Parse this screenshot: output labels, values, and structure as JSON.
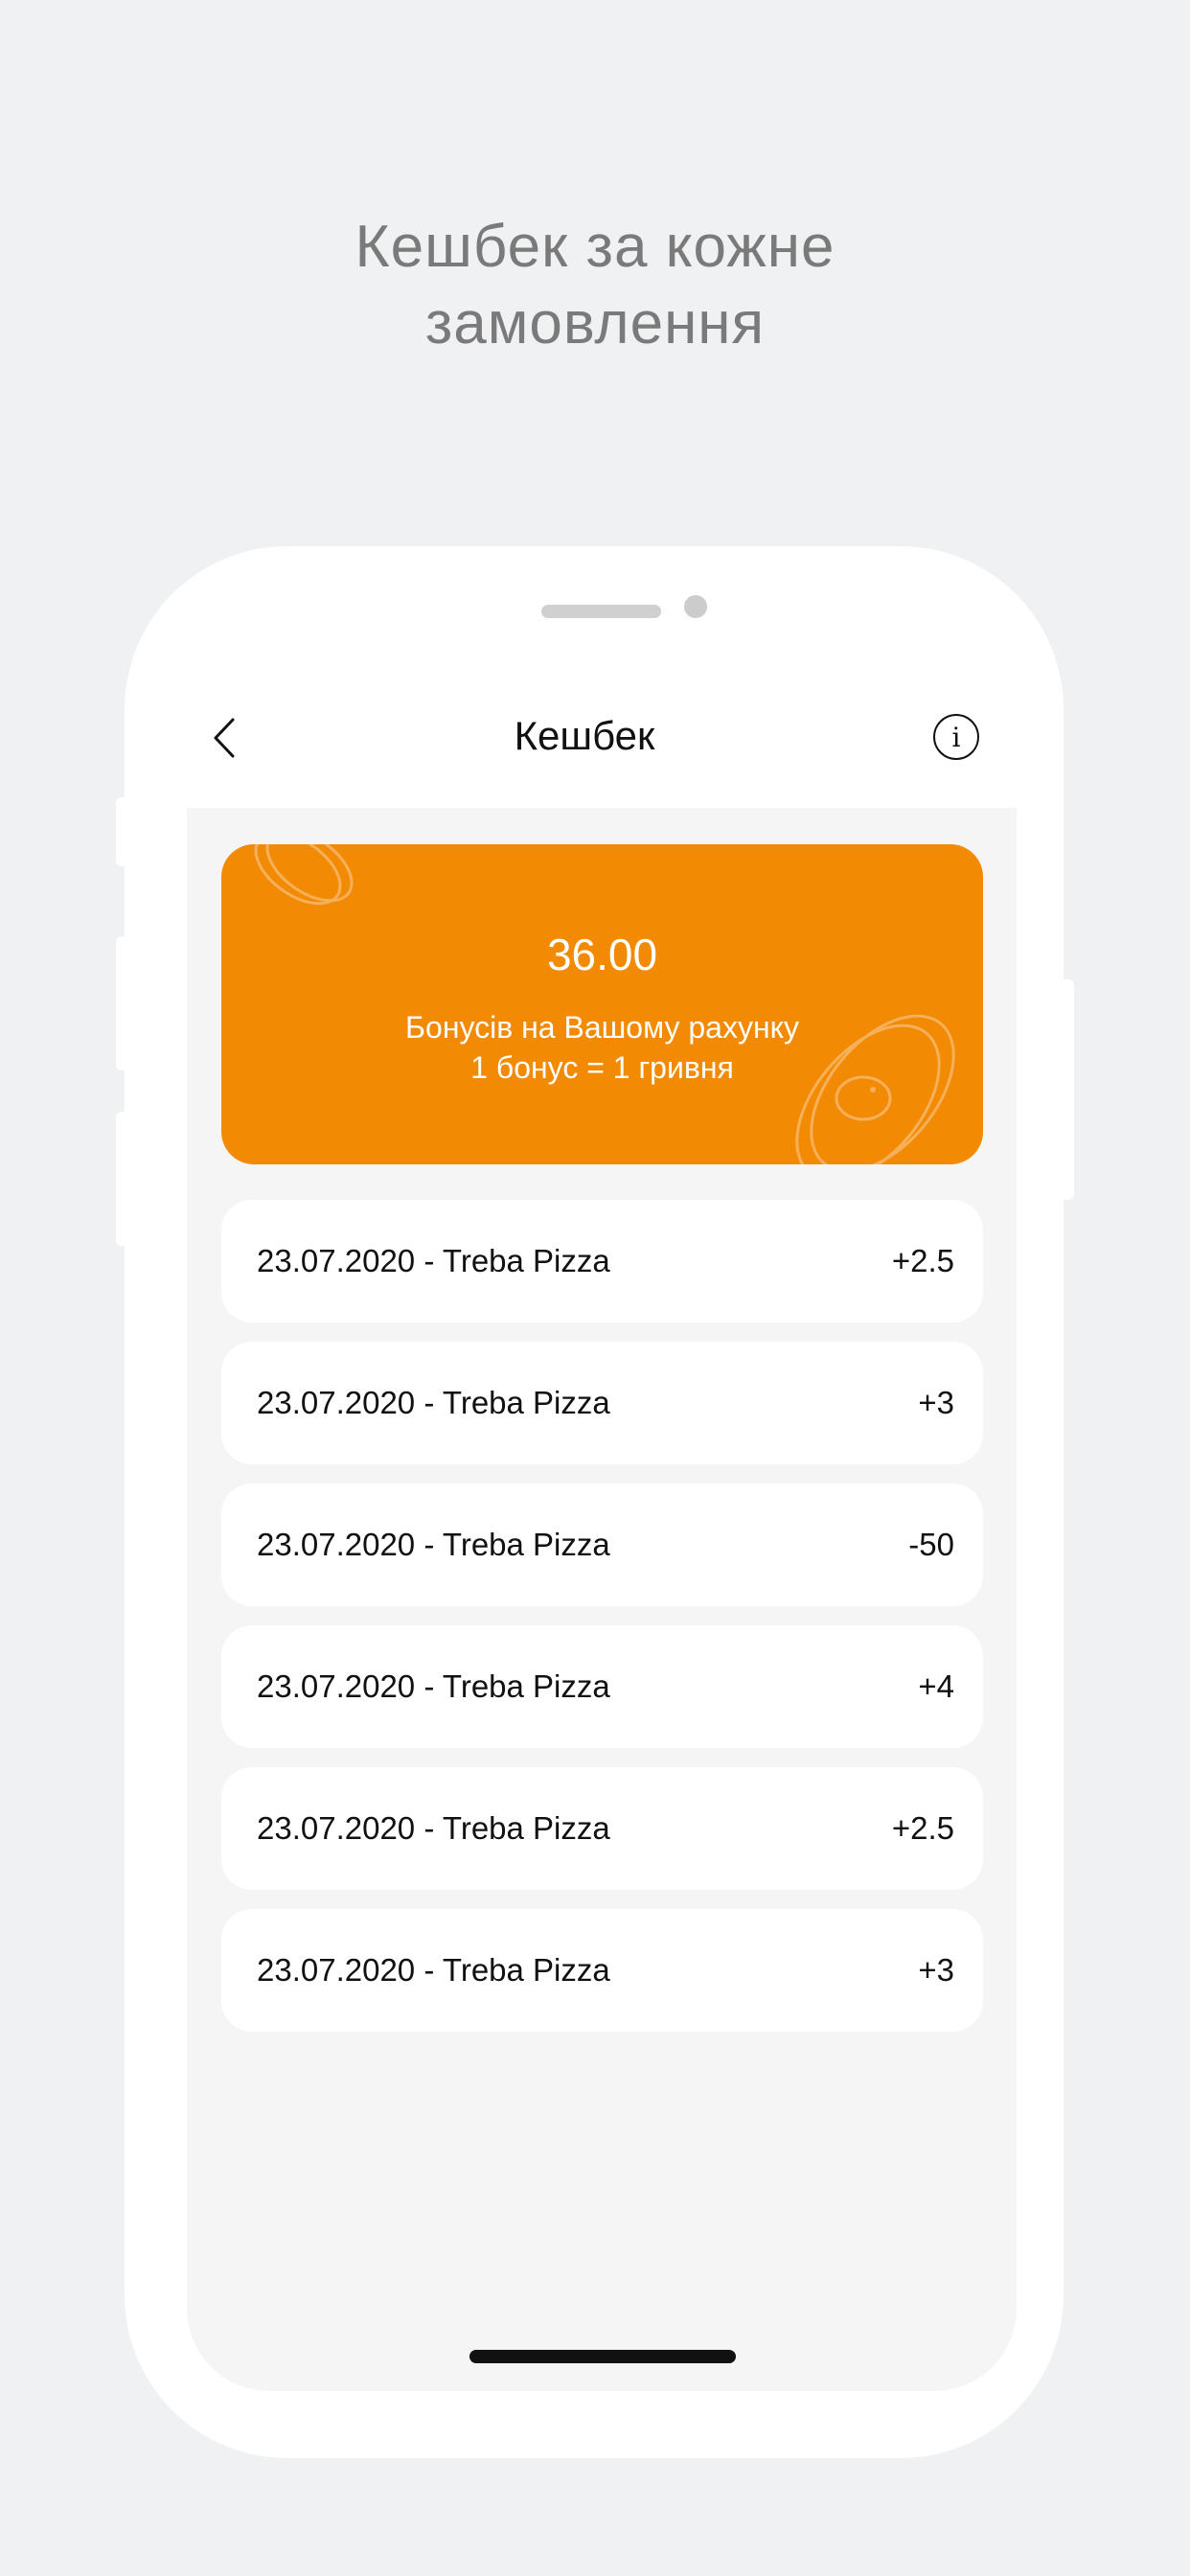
{
  "promo": {
    "title_line1": "Кешбек за кожне",
    "title_line2": "замовлення"
  },
  "nav": {
    "back_icon": "chevron-left-icon",
    "title": "Кешбек",
    "info_icon": "info-icon",
    "info_glyph": "i"
  },
  "bonus": {
    "amount": "36.00",
    "caption_line1": "Бонусів на Вашому рахунку",
    "caption_line2": "1 бонус = 1 гривня",
    "card_color": "#f28a03"
  },
  "transactions": [
    {
      "label": "23.07.2020 - Treba Pizza",
      "amount": "+2.5"
    },
    {
      "label": "23.07.2020 - Treba Pizza",
      "amount": "+3"
    },
    {
      "label": "23.07.2020 - Treba Pizza",
      "amount": "-50"
    },
    {
      "label": "23.07.2020 - Treba Pizza",
      "amount": "+4"
    },
    {
      "label": "23.07.2020 - Treba Pizza",
      "amount": "+2.5"
    },
    {
      "label": "23.07.2020 - Treba Pizza",
      "amount": "+3"
    }
  ]
}
